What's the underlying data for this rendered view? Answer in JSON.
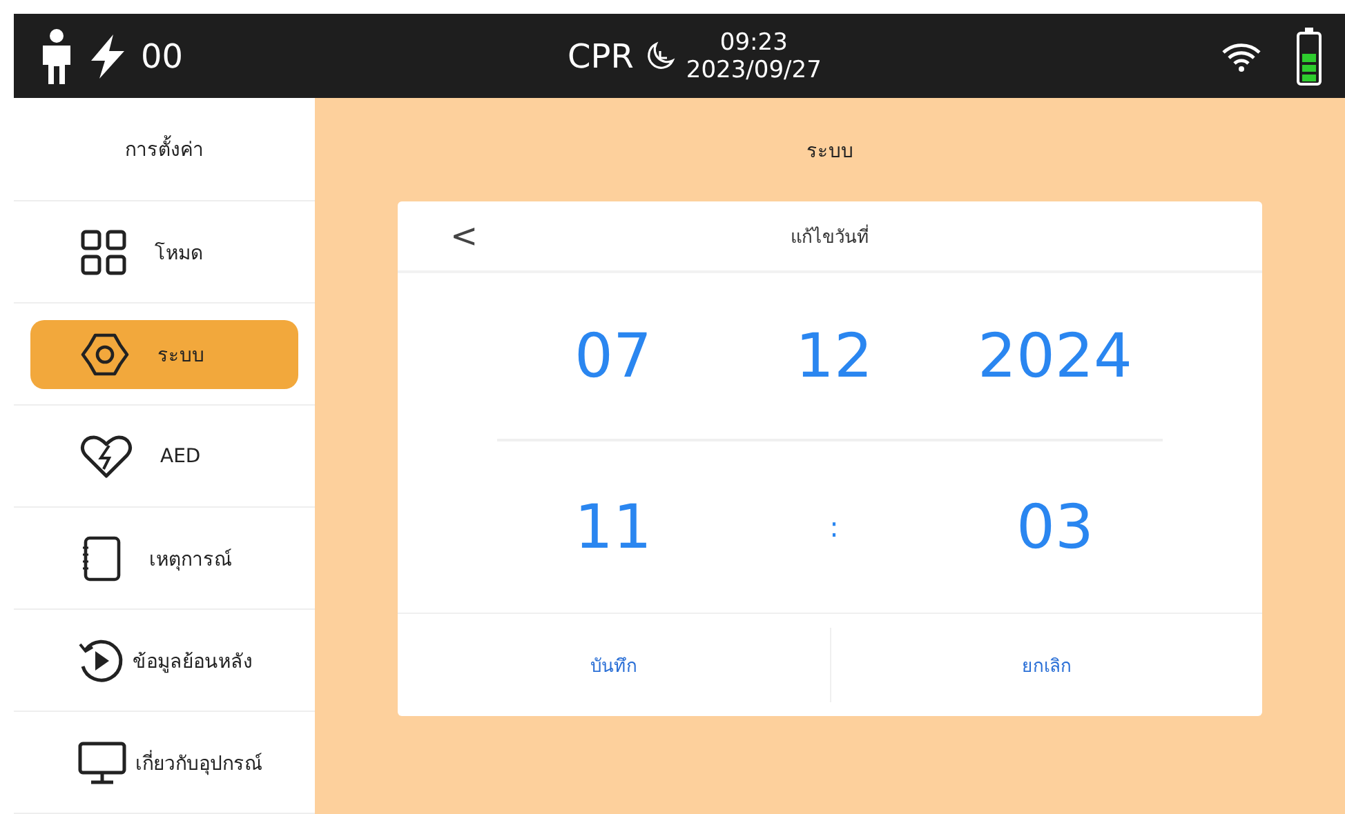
{
  "status_bar": {
    "shock_count": "00",
    "mode": "CPR",
    "time": "09:23",
    "date": "2023/09/27"
  },
  "sidebar": {
    "title": "การตั้งค่า",
    "items": [
      {
        "label": "โหมด",
        "selected": false
      },
      {
        "label": "ระบบ",
        "selected": true
      },
      {
        "label": "AED",
        "selected": false
      },
      {
        "label": "เหตุการณ์",
        "selected": false
      },
      {
        "label": "ข้อมูลย้อนหลัง",
        "selected": false
      },
      {
        "label": "เกี่ยวกับอุปกรณ์",
        "selected": false
      }
    ]
  },
  "panel": {
    "title": "ระบบ"
  },
  "dialog": {
    "back": "<",
    "title": "แก้ไขวันที่",
    "date": [
      "07",
      "12",
      "2024"
    ],
    "time": [
      "11",
      ":",
      "03"
    ],
    "buttons": [
      "บันทึก",
      "ยกเลิก"
    ]
  }
}
